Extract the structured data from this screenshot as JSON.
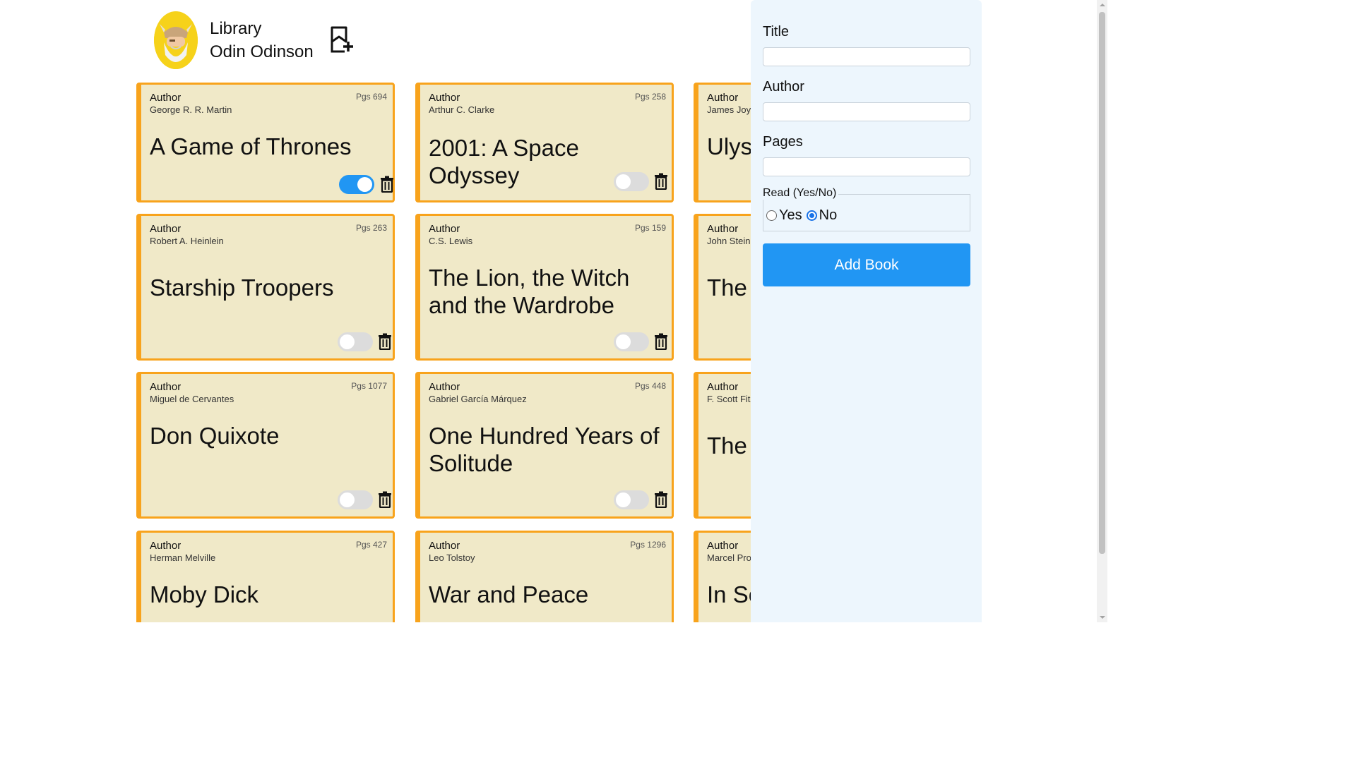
{
  "header": {
    "title": "Library",
    "user_name": "Odin Odinson"
  },
  "author_label": "Author",
  "cards": [
    {
      "author": "George R. R. Martin",
      "pages": "Pgs 694",
      "title": "A Game of Thrones",
      "read": true
    },
    {
      "author": "Arthur C. Clarke",
      "pages": "Pgs 258",
      "title": "2001: A Space Odyssey",
      "read": false
    },
    {
      "author": "James Joyce",
      "pages": "",
      "title": "Ulysses",
      "read": false
    },
    {
      "author": "Robert A. Heinlein",
      "pages": "Pgs 263",
      "title": "Starship Troopers",
      "read": false
    },
    {
      "author": "C.S. Lewis",
      "pages": "Pgs 159",
      "title": "The Lion, the Witch and the Wardrobe",
      "read": false
    },
    {
      "author": "John Steinbeck",
      "pages": "",
      "title": "The",
      "read": false
    },
    {
      "author": "Miguel de Cervantes",
      "pages": "Pgs 1077",
      "title": "Don Quixote",
      "read": false
    },
    {
      "author": "Gabriel García Márquez",
      "pages": "Pgs 448",
      "title": "One Hundred Years of Solitude",
      "read": false
    },
    {
      "author": "F. Scott Fitzgerald",
      "pages": "",
      "title": "The",
      "read": false
    },
    {
      "author": "Herman Melville",
      "pages": "Pgs 427",
      "title": "Moby Dick",
      "read": false
    },
    {
      "author": "Leo Tolstoy",
      "pages": "Pgs 1296",
      "title": "War and Peace",
      "read": false
    },
    {
      "author": "Marcel Proust",
      "pages": "",
      "title": "In Search",
      "read": false
    }
  ],
  "form": {
    "title_label": "Title",
    "title_value": "",
    "author_label": "Author",
    "author_value": "",
    "pages_label": "Pages",
    "pages_value": "",
    "read_legend": "Read (Yes/No)",
    "yes_label": "Yes",
    "no_label": "No",
    "read_selected": "No",
    "submit_label": "Add Book"
  },
  "colors": {
    "card_bg": "#f0e9c8",
    "card_border": "#f8a31c",
    "accent": "#2196f3",
    "sidebar_bg": "#edf6fd",
    "avatar_bg": "#f6d21a"
  },
  "icons": {
    "add": "bookmark-plus-icon",
    "delete": "trash-icon",
    "avatar": "viking-avatar"
  }
}
